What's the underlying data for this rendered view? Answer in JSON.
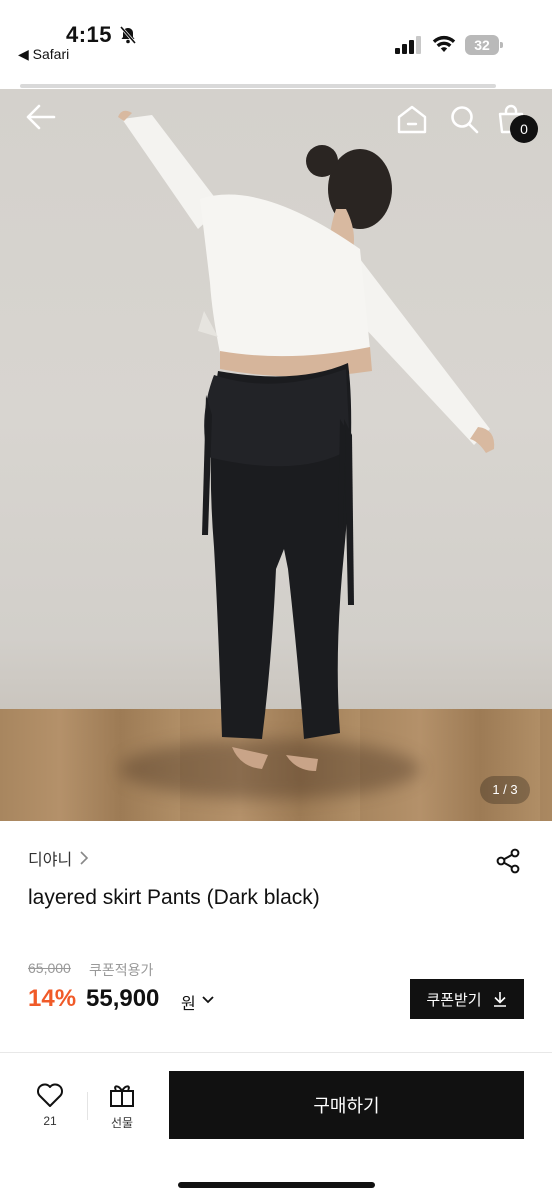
{
  "status_bar": {
    "time": "4:15",
    "back_app": "◀ Safari",
    "battery": "32"
  },
  "header": {
    "cart_count": "0"
  },
  "gallery": {
    "page_indicator": "1 / 3"
  },
  "product": {
    "brand": "디야니",
    "title": "layered skirt Pants (Dark black)",
    "original_price": "65,000",
    "coupon_note": "쿠폰적용가",
    "discount_rate": "14%",
    "sale_price": "55,900",
    "currency": "원",
    "coupon_button": "쿠폰받기"
  },
  "bottom_bar": {
    "like_count": "21",
    "gift_label": "선물",
    "buy_label": "구매하기"
  },
  "colors": {
    "discount": "#f05a28",
    "primary": "#111111"
  },
  "icons": [
    "mute-icon",
    "signal-icon",
    "wifi-icon",
    "back-arrow-icon",
    "home-icon",
    "search-icon",
    "cart-icon",
    "share-icon",
    "chevron-right-icon",
    "chevron-down-icon",
    "download-icon",
    "heart-icon",
    "gift-icon"
  ]
}
